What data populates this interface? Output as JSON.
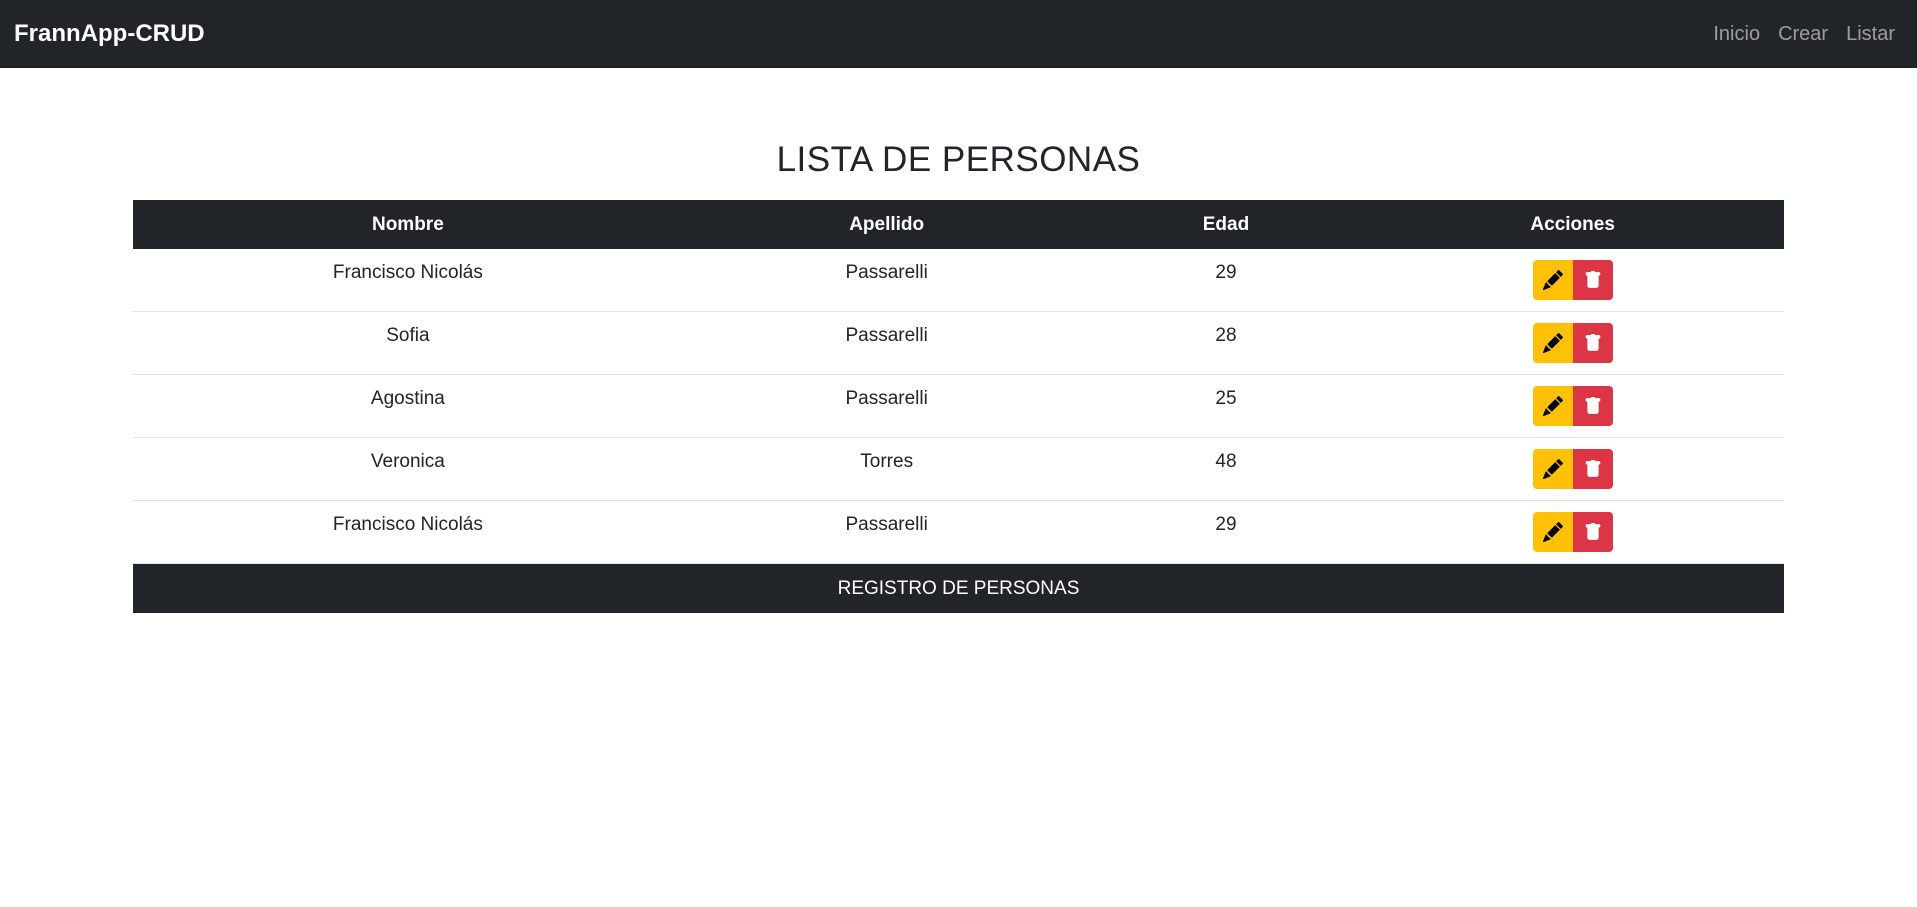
{
  "navbar": {
    "brand": "FrannApp-CRUD",
    "links": [
      "Inicio",
      "Crear",
      "Listar"
    ]
  },
  "page": {
    "title": "LISTA DE PERSONAS"
  },
  "table": {
    "headers": [
      "Nombre",
      "Apellido",
      "Edad",
      "Acciones"
    ],
    "rows": [
      {
        "nombre": "Francisco Nicolás",
        "apellido": "Passarelli",
        "edad": "29"
      },
      {
        "nombre": "Sofia",
        "apellido": "Passarelli",
        "edad": "28"
      },
      {
        "nombre": "Agostina",
        "apellido": "Passarelli",
        "edad": "25"
      },
      {
        "nombre": "Veronica",
        "apellido": "Torres",
        "edad": "48"
      },
      {
        "nombre": "Francisco Nicolás",
        "apellido": "Passarelli",
        "edad": "29"
      }
    ],
    "footer": "REGISTRO DE PERSONAS"
  },
  "icons": {
    "edit": "pencil-icon",
    "delete": "trash-icon"
  },
  "colors": {
    "navbar_bg": "#212529",
    "edit_button": "#ffc107",
    "delete_button": "#dc3545"
  }
}
